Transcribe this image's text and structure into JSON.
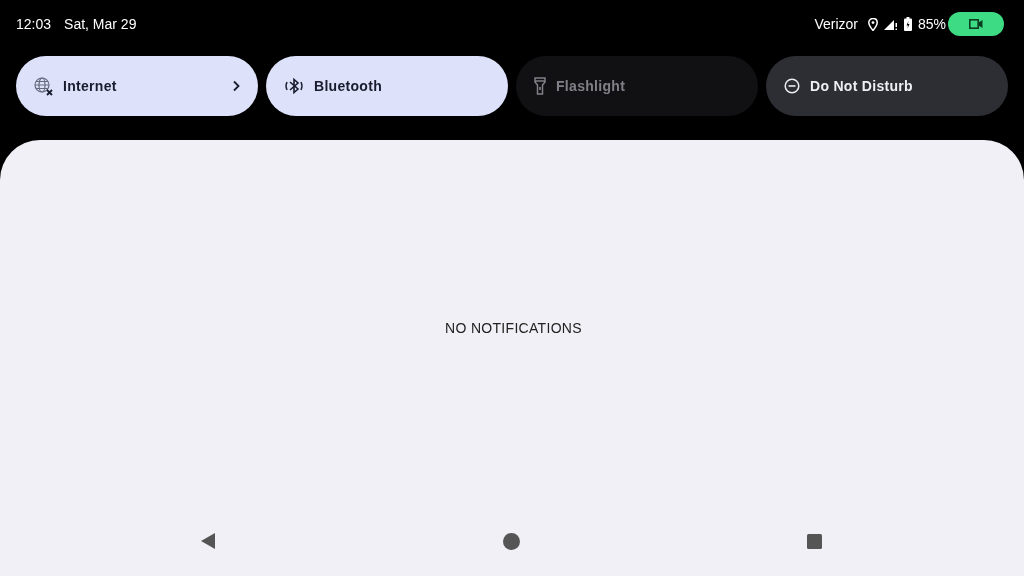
{
  "status_bar": {
    "time": "12:03",
    "date": "Sat, Mar 29",
    "carrier": "Verizor",
    "battery": "85%"
  },
  "tiles": [
    {
      "kind": "internet",
      "label": "Internet",
      "on": true,
      "disabled": false,
      "has_chevron": true
    },
    {
      "kind": "bluetooth",
      "label": "Bluetooth",
      "on": true,
      "disabled": false,
      "has_chevron": false
    },
    {
      "kind": "flashlight",
      "label": "Flashlight",
      "on": false,
      "disabled": true,
      "has_chevron": false
    },
    {
      "kind": "dnd",
      "label": "Do Not Disturb",
      "on": false,
      "disabled": false,
      "has_chevron": false
    }
  ],
  "notifications": {
    "empty_text": "NO NOTIFICATIONS"
  }
}
